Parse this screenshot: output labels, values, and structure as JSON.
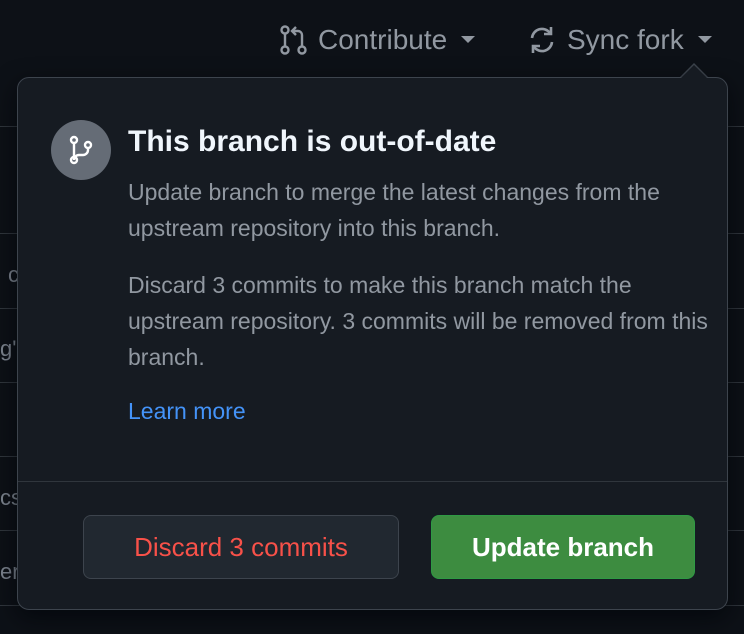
{
  "toolbar": {
    "contribute_label": "Contribute",
    "sync_label": "Sync fork"
  },
  "background": {
    "fragments": [
      "c",
      "g'",
      "cs",
      "er"
    ]
  },
  "popover": {
    "title": "This branch is out-of-date",
    "update_text": "Update branch to merge the latest changes from the upstream repository into this branch.",
    "discard_text": "Discard 3 commits to make this branch match the upstream repository. 3 commits will be removed from this branch.",
    "learn_more": "Learn more",
    "discard_button": "Discard 3 commits",
    "update_button": "Update branch"
  },
  "colors": {
    "danger": "#f85149",
    "link": "#4493f8",
    "success": "#3d8c40"
  },
  "icons": {
    "contribute": "git-pull-request-icon",
    "sync": "sync-icon",
    "branch": "git-branch-icon"
  }
}
